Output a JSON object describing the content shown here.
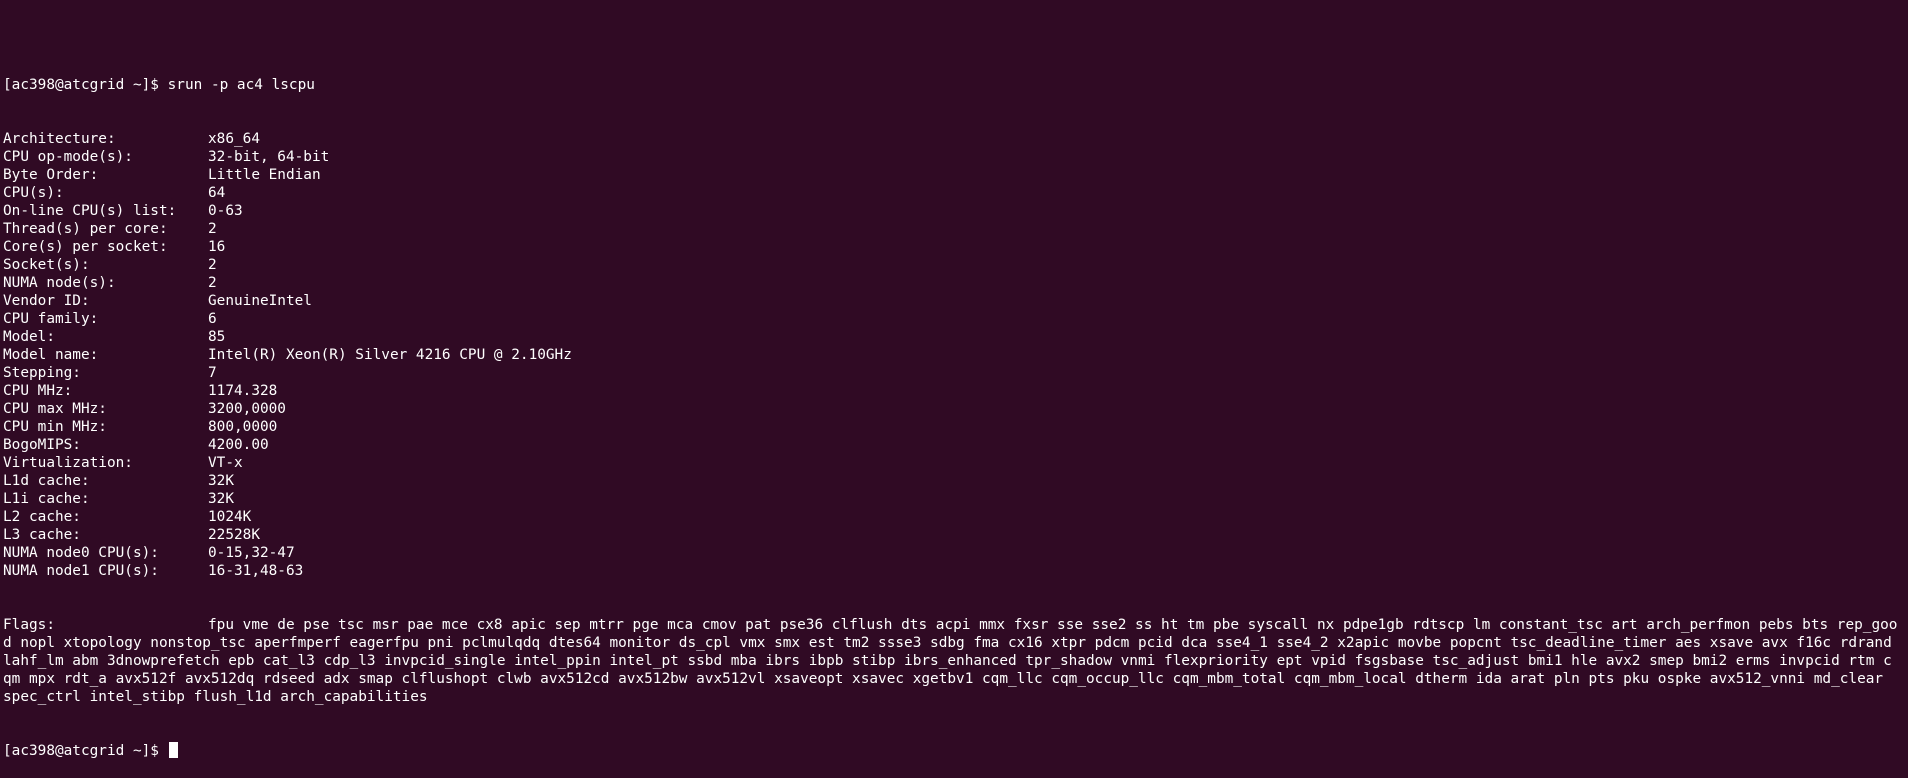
{
  "terminal": {
    "clipped_top_text": "                                 '",
    "command_prompt": "[ac398@atcgrid ~]$ ",
    "command": "srun -p ac4 lscpu",
    "rows": [
      {
        "key": "Architecture:",
        "value": "x86_64"
      },
      {
        "key": "CPU op-mode(s):",
        "value": "32-bit, 64-bit"
      },
      {
        "key": "Byte Order:",
        "value": "Little Endian"
      },
      {
        "key": "CPU(s):",
        "value": "64"
      },
      {
        "key": "On-line CPU(s) list:",
        "value": "0-63"
      },
      {
        "key": "Thread(s) per core:",
        "value": "2"
      },
      {
        "key": "Core(s) per socket:",
        "value": "16"
      },
      {
        "key": "Socket(s):",
        "value": "2"
      },
      {
        "key": "NUMA node(s):",
        "value": "2"
      },
      {
        "key": "Vendor ID:",
        "value": "GenuineIntel"
      },
      {
        "key": "CPU family:",
        "value": "6"
      },
      {
        "key": "Model:",
        "value": "85"
      },
      {
        "key": "Model name:",
        "value": "Intel(R) Xeon(R) Silver 4216 CPU @ 2.10GHz"
      },
      {
        "key": "Stepping:",
        "value": "7"
      },
      {
        "key": "CPU MHz:",
        "value": "1174.328"
      },
      {
        "key": "CPU max MHz:",
        "value": "3200,0000"
      },
      {
        "key": "CPU min MHz:",
        "value": "800,0000"
      },
      {
        "key": "BogoMIPS:",
        "value": "4200.00"
      },
      {
        "key": "Virtualization:",
        "value": "VT-x"
      },
      {
        "key": "L1d cache:",
        "value": "32K"
      },
      {
        "key": "L1i cache:",
        "value": "32K"
      },
      {
        "key": "L2 cache:",
        "value": "1024K"
      },
      {
        "key": "L3 cache:",
        "value": "22528K"
      },
      {
        "key": "NUMA node0 CPU(s):",
        "value": "0-15,32-47"
      },
      {
        "key": "NUMA node1 CPU(s):",
        "value": "16-31,48-63"
      }
    ],
    "flags_key": "Flags:",
    "flags_value": "fpu vme de pse tsc msr pae mce cx8 apic sep mtrr pge mca cmov pat pse36 clflush dts acpi mmx fxsr sse sse2 ss ht tm pbe syscall nx pdpe1gb rdtscp lm constant_tsc art arch_perfmon pebs bts rep_good nopl xtopology nonstop_tsc aperfmperf eagerfpu pni pclmulqdq dtes64 monitor ds_cpl vmx smx est tm2 ssse3 sdbg fma cx16 xtpr pdcm pcid dca sse4_1 sse4_2 x2apic movbe popcnt tsc_deadline_timer aes xsave avx f16c rdrand lahf_lm abm 3dnowprefetch epb cat_l3 cdp_l3 invpcid_single intel_ppin intel_pt ssbd mba ibrs ibpb stibp ibrs_enhanced tpr_shadow vnmi flexpriority ept vpid fsgsbase tsc_adjust bmi1 hle avx2 smep bmi2 erms invpcid rtm cqm mpx rdt_a avx512f avx512dq rdseed adx smap clflushopt clwb avx512cd avx512bw avx512vl xsaveopt xsavec xgetbv1 cqm_llc cqm_occup_llc cqm_mbm_total cqm_mbm_local dtherm ida arat pln pts pku ospke avx512_vnni md_clear spec_ctrl intel_stibp flush_l1d arch_capabilities",
    "final_prompt": "[ac398@atcgrid ~]$ ",
    "colors": {
      "background": "#300a24",
      "foreground": "#ffffff"
    }
  }
}
